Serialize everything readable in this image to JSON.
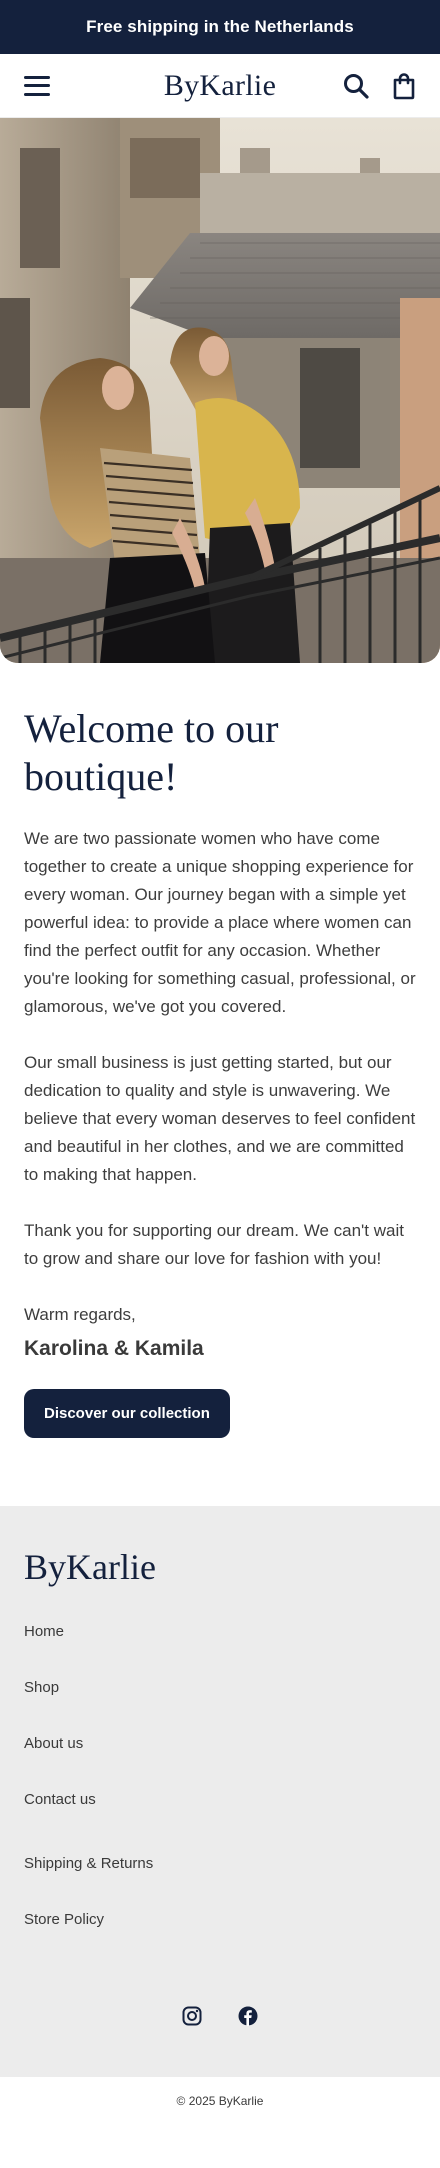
{
  "announcement": {
    "text": "Free shipping in the Netherlands"
  },
  "header": {
    "logo": "ByKarlie",
    "icons": {
      "menu": "hamburger-menu-icon",
      "search": "search-icon",
      "cart": "shopping-bag-icon"
    }
  },
  "hero": {
    "image": "two women leaning on a balcony railing"
  },
  "main": {
    "title": "Welcome to our boutique!",
    "paragraphs": [
      "We are two passionate women who have come together to create a unique shopping experience for every woman. Our journey began with a simple yet powerful idea: to provide a place where women can find the perfect outfit for any occasion. Whether you're looking for something casual, professional, or glamorous, we've got you covered.",
      "Our small business is just getting started, but our dedication to quality and style is unwavering. We believe that every woman deserves to feel confident and beautiful in her clothes, and we are committed to making that happen.",
      "Thank you for supporting our dream. We can't wait to grow and share our love for fashion with you!"
    ],
    "regards": "Warm regards,",
    "signature": "Karolina & Kamila",
    "cta_label": "Discover our collection"
  },
  "footer": {
    "logo": "ByKarlie",
    "primary_links": [
      "Home",
      "Shop",
      "About us",
      "Contact us"
    ],
    "secondary_links": [
      "Shipping & Returns",
      "Store Policy"
    ],
    "social": [
      "instagram-icon",
      "facebook-icon"
    ],
    "copyright": "© 2025 ByKarlie"
  },
  "colors": {
    "navy": "#14213d",
    "footer_bg": "#ececec",
    "text": "#3a3a3a"
  }
}
